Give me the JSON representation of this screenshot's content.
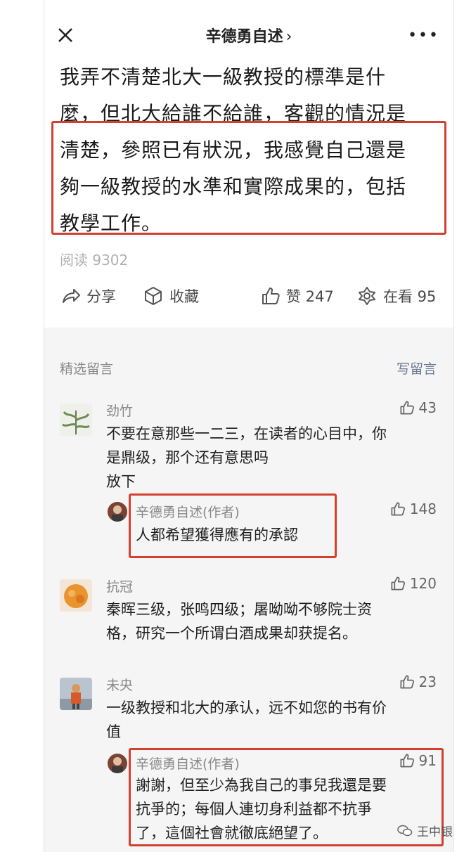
{
  "header": {
    "title": "辛德勇自述",
    "title_chevron": "›",
    "more": "•••"
  },
  "article": {
    "lines": [
      "我弄不清楚北大一級教授的標準是什",
      "麼，但北大給誰不給誰，客觀的情況是",
      "清楚，參照已有狀況，我感覺自己還是",
      "夠一級教授的水準和實際成果的，包括",
      "教學工作。"
    ],
    "reads": "阅读 9302"
  },
  "actions": {
    "share": "分享",
    "favorite": "收藏",
    "like": "赞 247",
    "watching": "在看 95"
  },
  "comments_section": {
    "title": "精选留言",
    "write": "写留言",
    "items": [
      {
        "name": "劲竹",
        "likes": "43",
        "lines": [
          "不要在意那些一二三，在读者的心目中，你",
          "是鼎级，那个还有意思吗",
          "放下"
        ],
        "reply": {
          "name": "辛德勇自述(作者)",
          "likes": "148",
          "lines": [
            "人都希望獲得應有的承認"
          ]
        }
      },
      {
        "name": "抗冠",
        "likes": "120",
        "lines": [
          "秦晖三级，张鸣四级；屠呦呦不够院士资",
          "格，研究一个所谓白酒成果却获提名。"
        ]
      },
      {
        "name": "未央",
        "likes": "23",
        "lines": [
          "一级教授和北大的承认，远不如您的书有价",
          "值"
        ],
        "reply": {
          "name": "辛德勇自述(作者)",
          "likes": "91",
          "lines": [
            "謝謝，但至少為我自己的事兒我還是要",
            "抗爭的；每個人連切身利益都不抗爭",
            "了，這個社會就徹底絕望了。"
          ]
        }
      }
    ]
  },
  "watermark": "王中银",
  "colors": {
    "highlight": "#d2402f",
    "background_comments": "#f5f5f5"
  }
}
